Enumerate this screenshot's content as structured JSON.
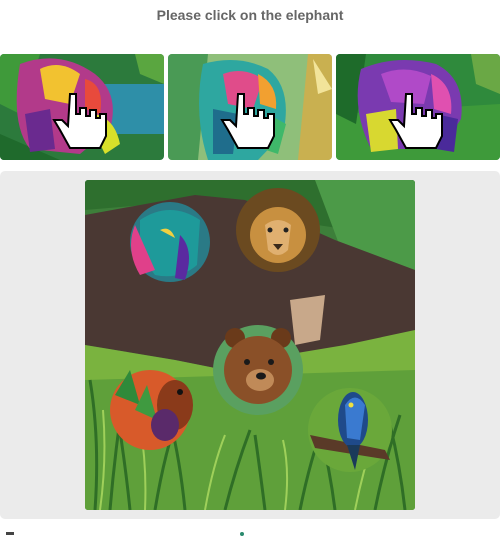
{
  "prompt": {
    "text": "Please click on the elephant"
  },
  "examples": [
    {
      "name": "example-elephant-1",
      "icon": "hand-pointer-icon"
    },
    {
      "name": "example-elephant-2",
      "icon": "hand-pointer-icon"
    },
    {
      "name": "example-elephant-3",
      "icon": "hand-pointer-icon"
    }
  ],
  "challenge": {
    "animals": [
      "elephant",
      "lion",
      "bear",
      "squirrel",
      "bird"
    ]
  },
  "colors": {
    "title": "#666666",
    "panel": "#ebebeb",
    "grass": "#6aa83a",
    "sky": "#2f7a35"
  }
}
